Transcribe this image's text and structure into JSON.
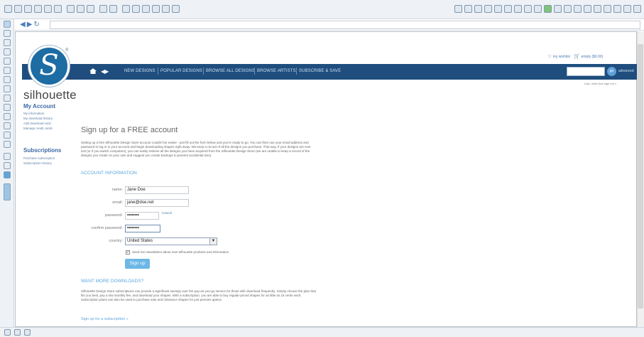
{
  "header": {
    "logo_text": "silhouette",
    "nav": [
      "NEW DESIGNS",
      "POPULAR DESIGNS",
      "BROWSE ALL DESIGNS",
      "BROWSE ARTISTS",
      "SUBSCRIBE & SAVE"
    ],
    "wishlist": "my wishlist",
    "cart": "empty ($0.00)",
    "search_go": "go",
    "advanced": "advanced",
    "user_line": "Lisa, Jane Doe sign out »"
  },
  "sidebar": {
    "account_heading": "My Account",
    "account_links": [
      "My information",
      "My download history",
      "Add download card",
      "Manage credit cards"
    ],
    "subscriptions_heading": "Subscriptions",
    "subscription_links": [
      "Purchase subscription",
      "Subscription History"
    ]
  },
  "main": {
    "title": "Sign up for a FREE account",
    "intro": "Setting up a free Silhouette Design Store account couldn't be easier - just fill out the form below and you're ready to go. You can then use your email address and password to log in to your account and begin downloading shapes right away. We keep a record of all the designs you purchase. That way, if your designs are ever lost (or if you switch computers), you can easily retrieve all the designs you have acquired from the Silhouette Design Store (we are unable to keep a record of the designs you create on your own and suggest you create backups to prevent accidental loss).",
    "account_heading": "ACCOUNT INFORMATION",
    "form": {
      "name_label": "name:",
      "name_value": "Jane Doe",
      "email_label": "email:",
      "email_value": "jane@doe.net",
      "password_label": "password:",
      "password_value": "••••••••",
      "cancel": "Cancel",
      "confirm_label": "confirm password:",
      "confirm_value": "••••••••",
      "country_label": "country:",
      "country_value": "United States",
      "newsletter": "Send me newsletters about new Silhouette products and information",
      "newsletter_checked": true,
      "submit": "Sign up"
    },
    "more_heading": "WANT MORE DOWNLOADS?",
    "more_text": "Silhouette Design Store subscriptions can provide a significant savings over the pay-as-you-go service for those with download frequently. Simply choose the plan that fits you best, pay a low monthly fee, and download your shapes. With a subscription, you are able to buy regular-priced shapes for as little as 15 cents each. Subscription plans can also be used to purchase sale and clearance shapes for just pennies apiece.",
    "subscription_link": "Sign up for a subscription »"
  },
  "colors": {
    "nav_band": "#1e4d7e",
    "logo_blue": "#1d6ca4",
    "accent": "#5ea7dc",
    "button": "#6cb7e6"
  }
}
